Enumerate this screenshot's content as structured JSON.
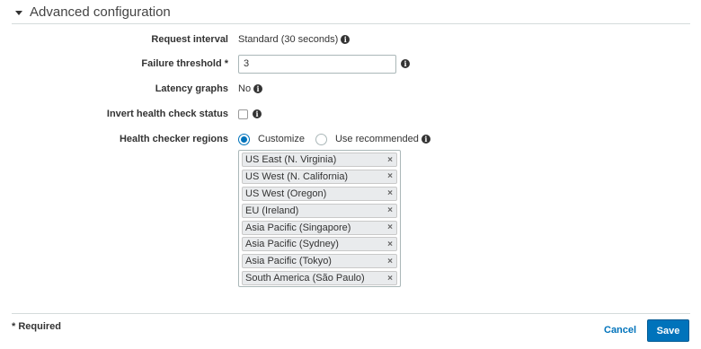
{
  "section": {
    "title": "Advanced configuration"
  },
  "fields": {
    "request_interval": {
      "label": "Request interval",
      "value": "Standard (30 seconds)"
    },
    "failure_threshold": {
      "label": "Failure threshold *",
      "value": "3"
    },
    "latency_graphs": {
      "label": "Latency graphs",
      "value": "No"
    },
    "invert_status": {
      "label": "Invert health check status",
      "checked": false
    },
    "health_checker_regions": {
      "label": "Health checker regions",
      "options": [
        {
          "label": "Customize",
          "selected": true
        },
        {
          "label": "Use recommended",
          "selected": false
        }
      ],
      "regions": [
        "US East (N. Virginia)",
        "US West (N. California)",
        "US West (Oregon)",
        "EU (Ireland)",
        "Asia Pacific (Singapore)",
        "Asia Pacific (Sydney)",
        "Asia Pacific (Tokyo)",
        "South America (São Paulo)"
      ],
      "remove_glyph": "×"
    }
  },
  "footer": {
    "required_note": "* Required",
    "cancel_label": "Cancel",
    "save_label": "Save"
  },
  "icons": {
    "info": "i"
  },
  "colors": {
    "accent": "#0073bb",
    "border": "#aab7b8",
    "chip_bg": "#e9ebed"
  }
}
